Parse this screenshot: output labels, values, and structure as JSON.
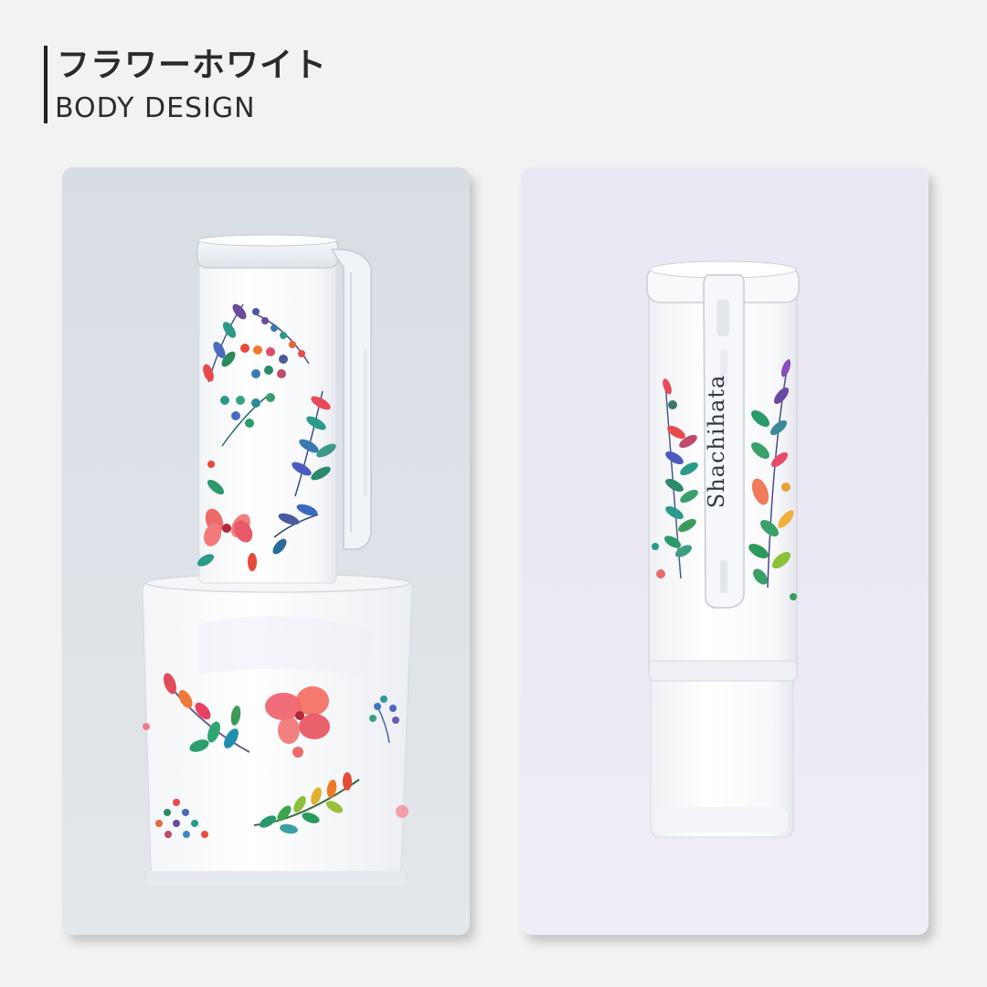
{
  "header": {
    "title_ja": "フラワーホワイト",
    "title_en": "BODY DESIGN"
  },
  "product": {
    "brand_label": "Shachihata"
  },
  "colors": {
    "page_background": "#f2f2f2",
    "left_panel_background": "#dde2e8",
    "right_panel_background": "#ece9f4",
    "title_text": "#2a2a2a"
  }
}
